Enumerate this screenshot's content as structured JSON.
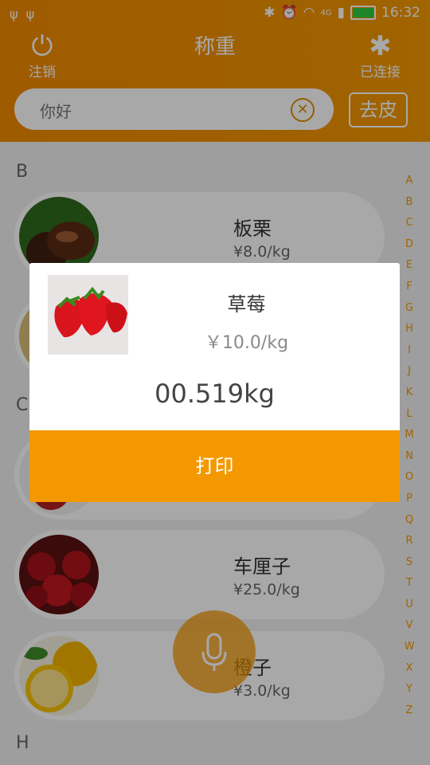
{
  "status": {
    "time": "16:32",
    "net": "4G"
  },
  "header": {
    "title": "称重",
    "logout_label": "注销",
    "bt_label": "已连接",
    "tare_label": "去皮"
  },
  "search": {
    "value": "你好"
  },
  "sections": {
    "b": "B",
    "c": "C",
    "h": "H"
  },
  "items": [
    {
      "name": "板栗",
      "price": "¥8.0/kg"
    },
    {
      "name": "车厘子",
      "price": "¥25.0/kg"
    },
    {
      "name": "橙子",
      "price": "¥3.0/kg"
    }
  ],
  "index_letters": [
    "A",
    "B",
    "C",
    "D",
    "E",
    "F",
    "G",
    "H",
    "I",
    "J",
    "K",
    "L",
    "M",
    "N",
    "O",
    "P",
    "Q",
    "R",
    "S",
    "T",
    "U",
    "V",
    "W",
    "X",
    "Y",
    "Z"
  ],
  "dialog": {
    "name": "草莓",
    "price": "￥10.0/kg",
    "weight": "00.519kg",
    "print_label": "打印"
  },
  "colors": {
    "accent": "#f39800",
    "header": "#f18a00"
  }
}
